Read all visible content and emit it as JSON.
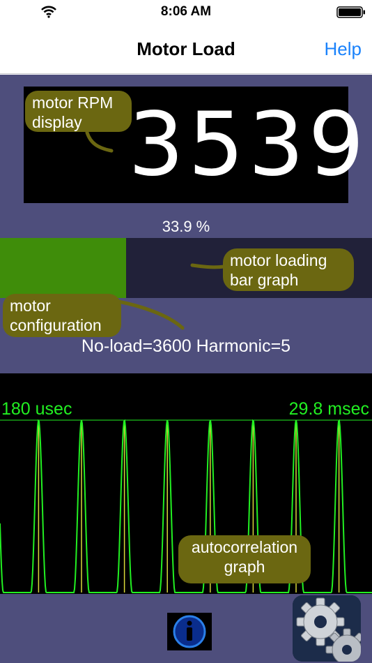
{
  "status_bar": {
    "time": "8:06 AM"
  },
  "nav": {
    "title": "Motor Load",
    "help": "Help"
  },
  "rpm": {
    "value": "3539"
  },
  "load": {
    "percent_label": "33.9 %",
    "fraction": 0.339
  },
  "config": {
    "text": "No-load=3600 Harmonic=5"
  },
  "graph": {
    "left_label": "180 usec",
    "right_label": "29.8 msec"
  },
  "callouts": {
    "rpm_line1": "motor RPM",
    "rpm_line2": "display",
    "load_line1": "motor loading",
    "load_line2": "bar graph",
    "config_line1": "motor",
    "config_line2": "configuration",
    "auto_line1": "autocorrelation",
    "auto_line2": "graph"
  },
  "icons": {
    "wifi": "wifi-icon",
    "battery": "battery-icon",
    "info": "info-icon",
    "settings": "gears-icon"
  },
  "colors": {
    "background": "#4e4e7c",
    "bar_fill": "#3f8d0a",
    "bar_track": "#212139",
    "trace": "#22f022",
    "marker": "#d8d83a",
    "help": "#1a82fb",
    "callout": "#6b6711"
  }
}
